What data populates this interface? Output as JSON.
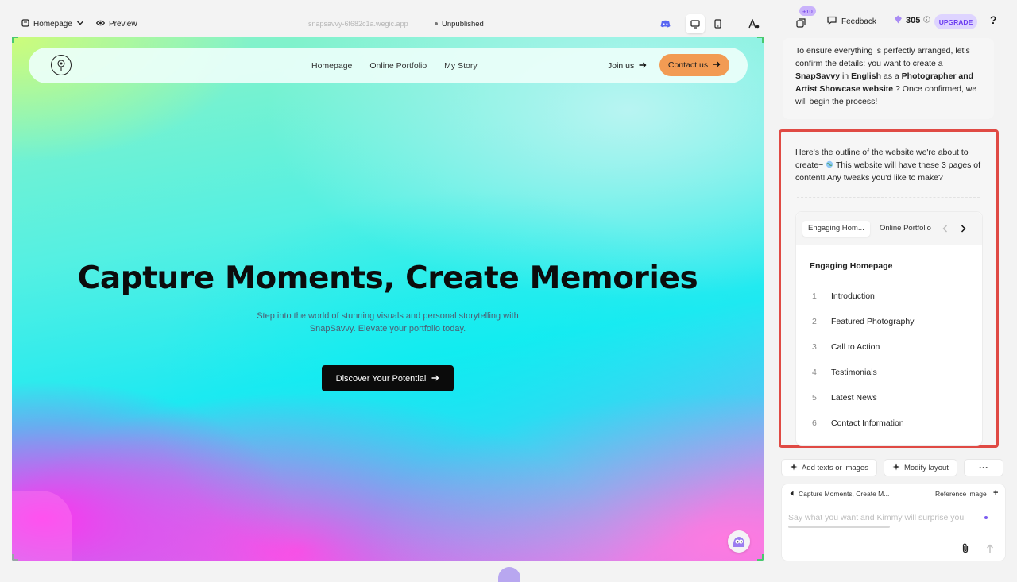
{
  "editor": {
    "page_selector": "Homepage",
    "preview_label": "Preview",
    "domain": "snapsavvy-6f682c1a.wegic.app",
    "status": "Unpublished"
  },
  "site": {
    "nav_links": [
      "Homepage",
      "Online Portfolio",
      "My Story"
    ],
    "join_label": "Join us",
    "contact_label": "Contact us",
    "hero_title": "Capture Moments, Create Memories",
    "hero_subtitle": "Step into the world of stunning visuals and personal storytelling with SnapSavvy. Elevate your portfolio today.",
    "cta_label": "Discover Your Potential"
  },
  "panel": {
    "badge": "+10",
    "feedback_label": "Feedback",
    "credits": "305",
    "upgrade_label": "UPGRADE",
    "help_label": "?",
    "msg1": {
      "p1": "To ensure everything is perfectly arranged, let's confirm the details: you want to create a ",
      "name": "SnapSavvy",
      "p2": " in ",
      "language": "English",
      "p3": " as a ",
      "type": "Photographer and Artist Showcase website",
      "p4": " ? Once confirmed, we will begin the process!"
    },
    "msg2": {
      "text_a": "Here's the outline of the website we're about to create~ ",
      "text_b": " This website will have these 3 pages of content! Any tweaks you'd like to make?"
    },
    "outline": {
      "tabs": [
        "Engaging Hom...",
        "Online Portfolio"
      ],
      "title": "Engaging Homepage",
      "items": [
        {
          "num": "1",
          "label": "Introduction"
        },
        {
          "num": "2",
          "label": "Featured Photography"
        },
        {
          "num": "3",
          "label": "Call to Action"
        },
        {
          "num": "4",
          "label": "Testimonials"
        },
        {
          "num": "5",
          "label": "Latest News"
        },
        {
          "num": "6",
          "label": "Contact Information"
        }
      ]
    },
    "actions": {
      "add_label": "Add texts or images",
      "modify_label": "Modify layout",
      "more_label": "···"
    },
    "composer": {
      "ref_text": "Capture Moments, Create M...",
      "ref_image_label": "Reference image",
      "placeholder": "Say what you want and Kimmy will surprise you"
    }
  },
  "colors": {
    "accent_purple": "#6b3cf0",
    "contact_orange": "#f29b53",
    "highlight_red": "#e04a44"
  }
}
